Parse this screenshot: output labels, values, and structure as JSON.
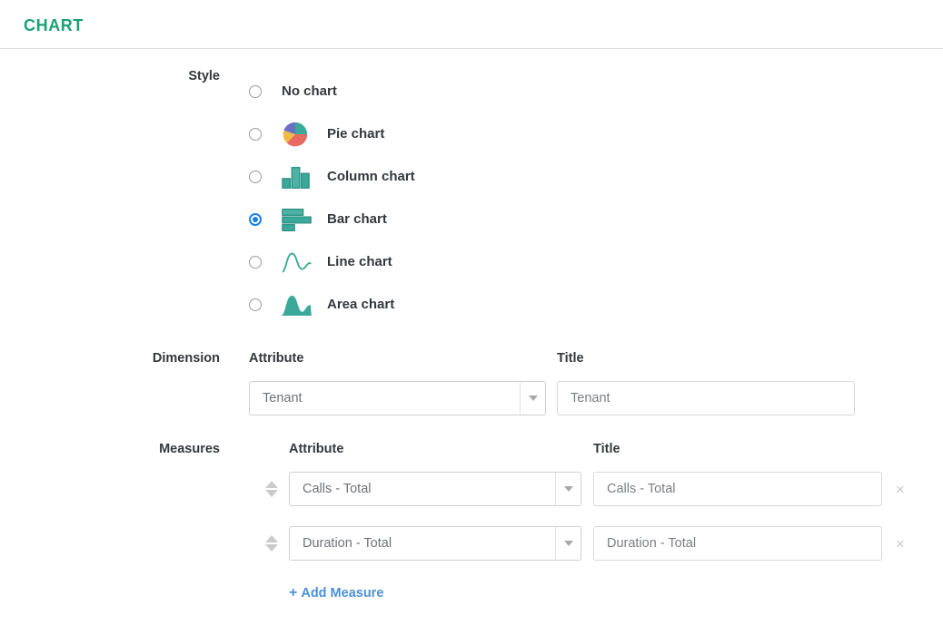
{
  "section": {
    "title": "CHART",
    "accent_color": "#1aa179"
  },
  "style": {
    "label": "Style",
    "selected": "bar",
    "options": [
      {
        "id": "none",
        "label": "No chart",
        "icon": null
      },
      {
        "id": "pie",
        "label": "Pie chart",
        "icon": "pie-chart-icon"
      },
      {
        "id": "column",
        "label": "Column chart",
        "icon": "column-chart-icon"
      },
      {
        "id": "bar",
        "label": "Bar chart",
        "icon": "bar-chart-icon"
      },
      {
        "id": "line",
        "label": "Line chart",
        "icon": "line-chart-icon"
      },
      {
        "id": "area",
        "label": "Area chart",
        "icon": "area-chart-icon"
      }
    ],
    "icon_colors": {
      "teal": "#3aa99a",
      "pie_teal": "#3aa99a",
      "pie_purple": "#6b6fc4",
      "pie_yellow": "#f0bb42",
      "pie_red": "#e8695f"
    },
    "radio_selected_color": "#1b7fe0"
  },
  "dimension": {
    "label": "Dimension",
    "attribute_caption": "Attribute",
    "title_caption": "Title",
    "attribute_value": "Tenant",
    "title_value": "Tenant"
  },
  "measures": {
    "label": "Measures",
    "attribute_caption": "Attribute",
    "title_caption": "Title",
    "rows": [
      {
        "attribute": "Calls - Total",
        "title": "Calls - Total",
        "remove_glyph": "×",
        "sort_handle": "sort-handle-icon"
      },
      {
        "attribute": "Duration - Total",
        "title": "Duration - Total",
        "remove_glyph": "×",
        "sort_handle": "sort-handle-icon"
      }
    ],
    "add_label": "Add Measure",
    "add_plus": "+",
    "add_color": "#4a90d9"
  }
}
